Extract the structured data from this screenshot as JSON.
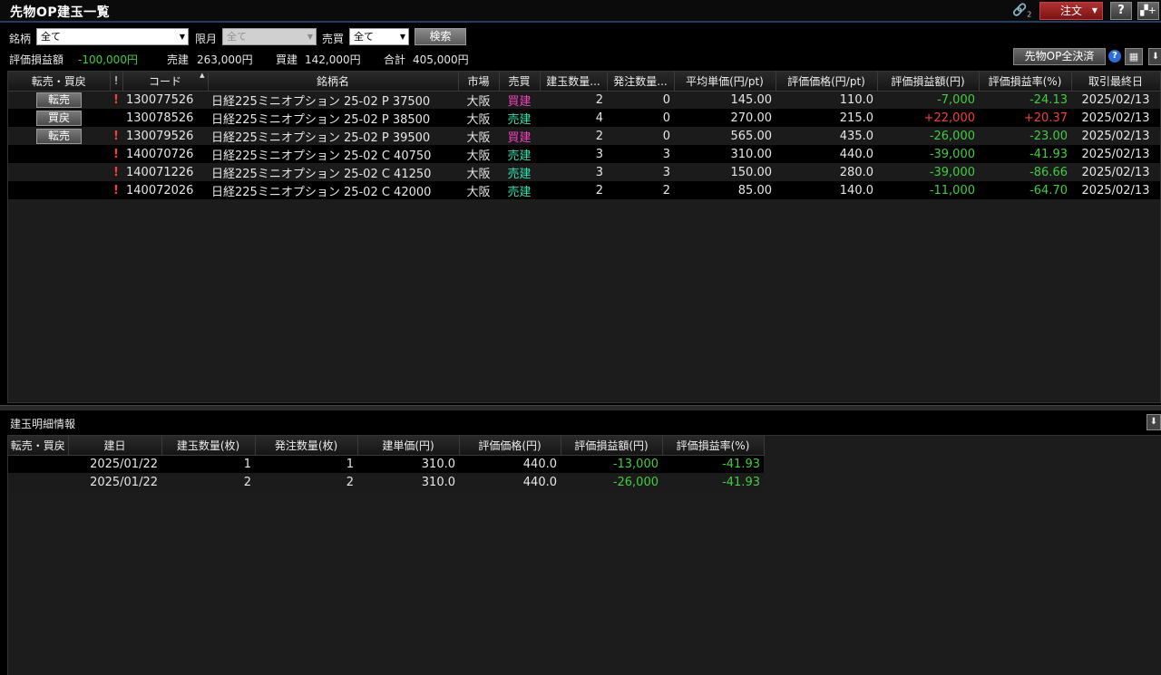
{
  "window": {
    "title": "先物OP建玉一覧"
  },
  "titlebar": {
    "link_icon_badge": "2",
    "order_label": "注文",
    "help_label": "?",
    "newwin_label": "+"
  },
  "filters": {
    "brand_label": "銘柄",
    "brand_value": "全て",
    "month_label": "限月",
    "month_value": "全て",
    "side_label": "売買",
    "side_value": "全て",
    "search_label": "検索"
  },
  "summary": {
    "pl_label": "評価損益額",
    "pl_value": "-100,000円",
    "sell_label": "売建",
    "sell_value": "263,000円",
    "buy_label": "買建",
    "buy_value": "142,000円",
    "total_label": "合計",
    "total_value": "405,000円",
    "allclose_label": "先物OP全決済",
    "help_icon": "?"
  },
  "main_table": {
    "headers": [
      "転売・買戻",
      "!",
      "コード",
      "銘柄名",
      "市場",
      "売買",
      "建玉数量...",
      "発注数量...",
      "平均単価(円/pt)",
      "評価価格(円/pt)",
      "評価損益額(円)",
      "評価損益率(%)",
      "取引最終日"
    ],
    "rows": [
      {
        "action": "転売",
        "flag": "!",
        "code": "130077526",
        "name": "日経225ミニオプション 25-02 P 37500",
        "market": "大阪",
        "side": "買建",
        "qty": "2",
        "order_qty": "0",
        "avg": "145.00",
        "eval": "110.0",
        "pl": "-7,000",
        "rate": "-24.13",
        "last": "2025/02/13"
      },
      {
        "action": "買戻",
        "flag": "",
        "code": "130078526",
        "name": "日経225ミニオプション 25-02 P 38500",
        "market": "大阪",
        "side": "売建",
        "qty": "4",
        "order_qty": "0",
        "avg": "270.00",
        "eval": "215.0",
        "pl": "+22,000",
        "rate": "+20.37",
        "last": "2025/02/13"
      },
      {
        "action": "転売",
        "flag": "!",
        "code": "130079526",
        "name": "日経225ミニオプション 25-02 P 39500",
        "market": "大阪",
        "side": "買建",
        "qty": "2",
        "order_qty": "0",
        "avg": "565.00",
        "eval": "435.0",
        "pl": "-26,000",
        "rate": "-23.00",
        "last": "2025/02/13"
      },
      {
        "action": "",
        "flag": "!",
        "code": "140070726",
        "name": "日経225ミニオプション 25-02 C 40750",
        "market": "大阪",
        "side": "売建",
        "qty": "3",
        "order_qty": "3",
        "avg": "310.00",
        "eval": "440.0",
        "pl": "-39,000",
        "rate": "-41.93",
        "last": "2025/02/13"
      },
      {
        "action": "",
        "flag": "!",
        "code": "140071226",
        "name": "日経225ミニオプション 25-02 C 41250",
        "market": "大阪",
        "side": "売建",
        "qty": "3",
        "order_qty": "3",
        "avg": "150.00",
        "eval": "280.0",
        "pl": "-39,000",
        "rate": "-86.66",
        "last": "2025/02/13"
      },
      {
        "action": "",
        "flag": "!",
        "code": "140072026",
        "name": "日経225ミニオプション 25-02 C 42000",
        "market": "大阪",
        "side": "売建",
        "qty": "2",
        "order_qty": "2",
        "avg": "85.00",
        "eval": "140.0",
        "pl": "-11,000",
        "rate": "-64.70",
        "last": "2025/02/13"
      }
    ]
  },
  "detail": {
    "title": "建玉明細情報",
    "headers": [
      "転売・買戻",
      "建日",
      "建玉数量(枚)",
      "発注数量(枚)",
      "建単価(円)",
      "評価価格(円)",
      "評価損益額(円)",
      "評価損益率(%)"
    ],
    "rows": [
      {
        "action": "",
        "date": "2025/01/22",
        "qty": "1",
        "order_qty": "1",
        "price": "310.0",
        "eval": "440.0",
        "pl": "-13,000",
        "rate": "-41.93"
      },
      {
        "action": "",
        "date": "2025/01/22",
        "qty": "2",
        "order_qty": "2",
        "price": "310.0",
        "eval": "440.0",
        "pl": "-26,000",
        "rate": "-41.93"
      }
    ]
  },
  "colors": {
    "gain": "#f04040",
    "loss": "#3ecf3e",
    "buy_side": "#f040c0",
    "sell_side": "#2fe0b0",
    "accent_border": "#1e3f66"
  }
}
